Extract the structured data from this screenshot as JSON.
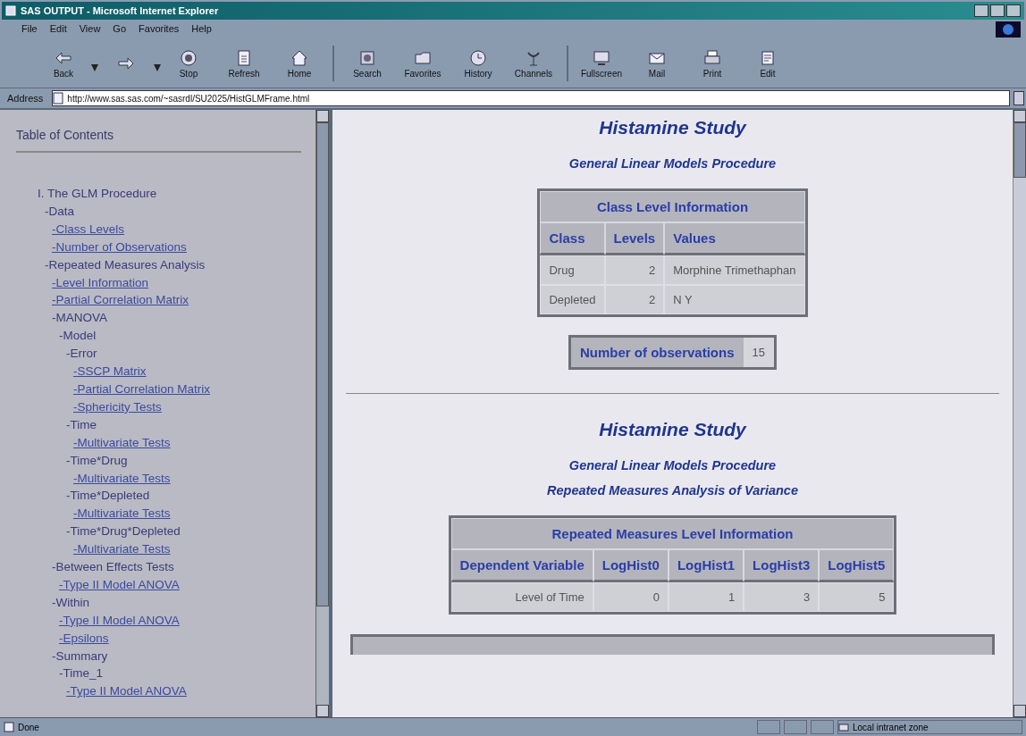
{
  "window": {
    "title": "SAS OUTPUT - Microsoft Internet Explorer"
  },
  "menu": [
    "File",
    "Edit",
    "View",
    "Go",
    "Favorites",
    "Help"
  ],
  "toolbar": [
    {
      "kind": "back",
      "label": "Back"
    },
    {
      "kind": "forward"
    },
    {
      "kind": "stop",
      "label": "Stop"
    },
    {
      "kind": "refresh",
      "label": "Refresh"
    },
    {
      "kind": "home",
      "label": "Home"
    },
    {
      "kind": "search",
      "label": "Search"
    },
    {
      "kind": "favorites",
      "label": "Favorites"
    },
    {
      "kind": "history",
      "label": "History"
    },
    {
      "kind": "channels",
      "label": "Channels"
    },
    {
      "kind": "fullscreen",
      "label": "Fullscreen"
    },
    {
      "kind": "mail",
      "label": "Mail"
    },
    {
      "kind": "print",
      "label": "Print"
    },
    {
      "kind": "edit",
      "label": "Edit"
    }
  ],
  "address": {
    "label": "Address",
    "value": "http://www.sas.sas.com/~sasrdl/SU2025/HistGLMFrame.html"
  },
  "toc": {
    "title": "Table of Contents",
    "items": [
      {
        "text": "I. The GLM Procedure",
        "kind": "heading",
        "children": [
          {
            "text": "-Data",
            "kind": "heading",
            "children": [
              {
                "text": "-Class Levels",
                "kind": "link"
              },
              {
                "text": "-Number of Observations",
                "kind": "link"
              }
            ]
          },
          {
            "text": "-Repeated Measures Analysis",
            "kind": "heading",
            "children": [
              {
                "text": "-Level Information",
                "kind": "link"
              },
              {
                "text": "-Partial Correlation Matrix",
                "kind": "link"
              },
              {
                "text": "-MANOVA",
                "kind": "heading",
                "children": [
                  {
                    "text": "-Model",
                    "kind": "heading",
                    "children": [
                      {
                        "text": "-Error",
                        "kind": "heading",
                        "children": [
                          {
                            "text": "-SSCP Matrix",
                            "kind": "link"
                          },
                          {
                            "text": "-Partial Correlation Matrix",
                            "kind": "link"
                          },
                          {
                            "text": "-Sphericity Tests",
                            "kind": "link"
                          }
                        ]
                      },
                      {
                        "text": "-Time",
                        "kind": "heading",
                        "children": [
                          {
                            "text": "-Multivariate Tests",
                            "kind": "link"
                          }
                        ]
                      },
                      {
                        "text": "-Time*Drug",
                        "kind": "heading",
                        "children": [
                          {
                            "text": "-Multivariate Tests",
                            "kind": "link"
                          }
                        ]
                      },
                      {
                        "text": "-Time*Depleted",
                        "kind": "heading",
                        "children": [
                          {
                            "text": "-Multivariate Tests",
                            "kind": "link"
                          }
                        ]
                      },
                      {
                        "text": "-Time*Drug*Depleted",
                        "kind": "heading",
                        "children": [
                          {
                            "text": "-Multivariate Tests",
                            "kind": "link"
                          }
                        ]
                      }
                    ]
                  }
                ]
              },
              {
                "text": "-Between Effects Tests",
                "kind": "heading",
                "children": [
                  {
                    "text": "-Type II Model ANOVA",
                    "kind": "link"
                  }
                ]
              },
              {
                "text": "-Within",
                "kind": "heading",
                "children": [
                  {
                    "text": "-Type II Model ANOVA",
                    "kind": "link"
                  },
                  {
                    "text": "-Epsilons",
                    "kind": "link"
                  }
                ]
              },
              {
                "text": "-Summary",
                "kind": "heading",
                "children": [
                  {
                    "text": "-Time_1",
                    "kind": "heading",
                    "children": [
                      {
                        "text": "-Type II Model ANOVA",
                        "kind": "link"
                      }
                    ]
                  }
                ]
              }
            ]
          }
        ]
      }
    ]
  },
  "report": [
    {
      "kind": "title",
      "text": "Histamine Study"
    },
    {
      "kind": "subtitle",
      "lines": [
        "General Linear Models Procedure"
      ]
    },
    {
      "kind": "table",
      "caption": "Class Level Information",
      "columns": [
        "Class",
        "Levels",
        "Values"
      ],
      "right_aligned": [
        false,
        true,
        false
      ],
      "rows": [
        [
          "Drug",
          "2",
          "Morphine Trimethaphan"
        ],
        [
          "Depleted",
          "2",
          "N Y"
        ]
      ]
    },
    {
      "kind": "keyvalue",
      "label": "Number of observations",
      "value": "15"
    },
    {
      "kind": "rule"
    },
    {
      "kind": "title",
      "text": "Histamine Study"
    },
    {
      "kind": "subtitle",
      "lines": [
        "General Linear Models Procedure",
        "Repeated Measures Analysis of Variance"
      ]
    },
    {
      "kind": "table",
      "caption": "Repeated Measures Level Information",
      "columns": [
        "Dependent Variable",
        "LogHist0",
        "LogHist1",
        "LogHist3",
        "LogHist5"
      ],
      "right_aligned": [
        true,
        true,
        true,
        true,
        true
      ],
      "rows": [
        [
          "Level of Time",
          "0",
          "1",
          "3",
          "5"
        ]
      ]
    },
    {
      "kind": "cut-table"
    }
  ],
  "status_bar": {
    "text": "Done",
    "zone": "Local intranet zone"
  }
}
